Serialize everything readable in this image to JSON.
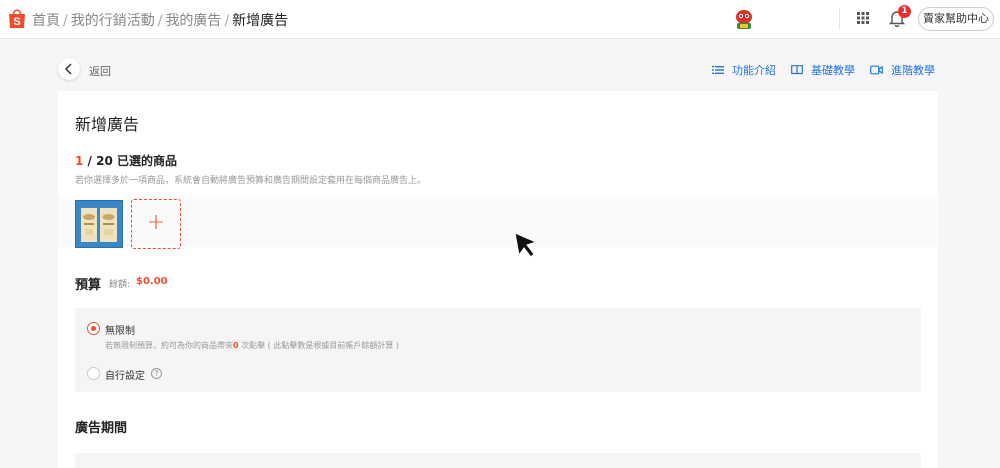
{
  "header": {
    "breadcrumbs": [
      "首頁",
      "我的行銷活動",
      "我的廣告"
    ],
    "current_page": "新增廣告",
    "separator": "/",
    "notification_count": "1",
    "help_button": "賣家幫助中心"
  },
  "subnav": {
    "back_label": "返回",
    "tutorials": [
      {
        "label": "功能介紹",
        "icon": "list-icon"
      },
      {
        "label": "基礎教學",
        "icon": "book-icon"
      },
      {
        "label": "進階教學",
        "icon": "video-icon"
      }
    ]
  },
  "form": {
    "title": "新增廣告",
    "selected_count": "1",
    "selected_suffix": " / 20 已選的商品",
    "selected_desc": "若你選擇多於一項商品，系統會自動將廣告預算和廣告期間設定套用在每個商品廣告上。",
    "add_symbol": "+",
    "budget_title": "預算",
    "balance_label": "餘額:",
    "balance_value": "$0.00",
    "budget_options": [
      {
        "label": "無限制",
        "selected": true
      },
      {
        "label": "自行設定",
        "selected": false
      }
    ],
    "unlimited_desc_pre": "若無限制預算，約可為你的商品帶來",
    "unlimited_desc_num": "0",
    "unlimited_desc_post": " 次點擊 ( 此點擊數是根據目前帳戶餘額計算 )",
    "help_symbol": "?",
    "period_title": "廣告期間"
  },
  "colors": {
    "brand": "#ee4d2d",
    "link": "#2673dd"
  }
}
